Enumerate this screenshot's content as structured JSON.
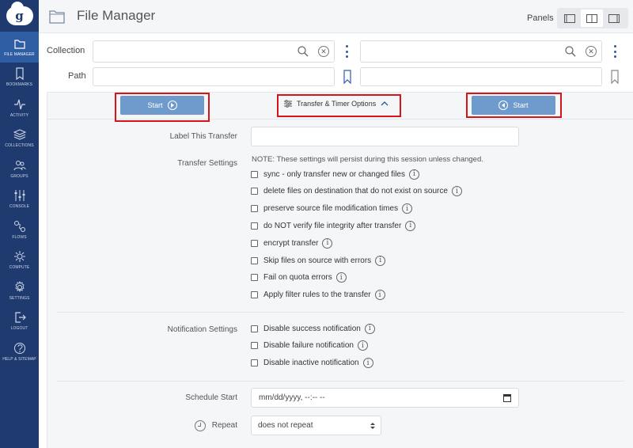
{
  "sidebar": {
    "logo_letter": "g",
    "items": [
      {
        "label": "FILE MANAGER",
        "icon": "folder-icon",
        "active": true
      },
      {
        "label": "BOOKMARKS",
        "icon": "bookmark-icon"
      },
      {
        "label": "ACTIVITY",
        "icon": "activity-icon"
      },
      {
        "label": "COLLECTIONS",
        "icon": "layers-icon"
      },
      {
        "label": "GROUPS",
        "icon": "groups-icon"
      },
      {
        "label": "CONSOLE",
        "icon": "sliders-icon"
      },
      {
        "label": "FLOWS",
        "icon": "flows-icon"
      },
      {
        "label": "COMPUTE",
        "icon": "compute-icon"
      },
      {
        "label": "SETTINGS",
        "icon": "gear-icon"
      },
      {
        "label": "LOGOUT",
        "icon": "logout-icon"
      },
      {
        "label": "HELP & SITEMAP",
        "icon": "help-icon"
      }
    ]
  },
  "header": {
    "title": "File Manager",
    "panels_label": "Panels"
  },
  "collection_label": "Collection",
  "path_label": "Path",
  "left": {
    "collection_value": "",
    "path_value": ""
  },
  "right": {
    "collection_value": "",
    "path_value": ""
  },
  "transfer_bar": {
    "start_left": "Start",
    "start_right": "Start",
    "options_label": "Transfer & Timer Options"
  },
  "form": {
    "label_transfer": "Label This Transfer",
    "label_value": "",
    "transfer_settings": "Transfer Settings",
    "note": "NOTE: These settings will persist during this session unless changed.",
    "transfer_options": [
      "sync - only transfer new or changed files",
      "delete files on destination that do not exist on source",
      "preserve source file modification times",
      "do NOT verify file integrity after transfer",
      "encrypt transfer",
      "Skip files on source with errors",
      "Fail on quota errors",
      "Apply filter rules to the transfer"
    ],
    "notification_settings": "Notification Settings",
    "notification_options": [
      "Disable success notification",
      "Disable failure notification",
      "Disable inactive notification"
    ],
    "schedule_start": "Schedule Start",
    "schedule_placeholder": "mm/dd/yyyy, --:-- --",
    "repeat": "Repeat",
    "repeat_value": "does not repeat",
    "info_glyph": "i"
  },
  "colors": {
    "sidebar": "#1f3a6e",
    "sidebar_active": "#2f5da3",
    "start_button": "#6f9bcc",
    "highlight_frame": "#d8141b",
    "accent": "#2f5da3"
  }
}
